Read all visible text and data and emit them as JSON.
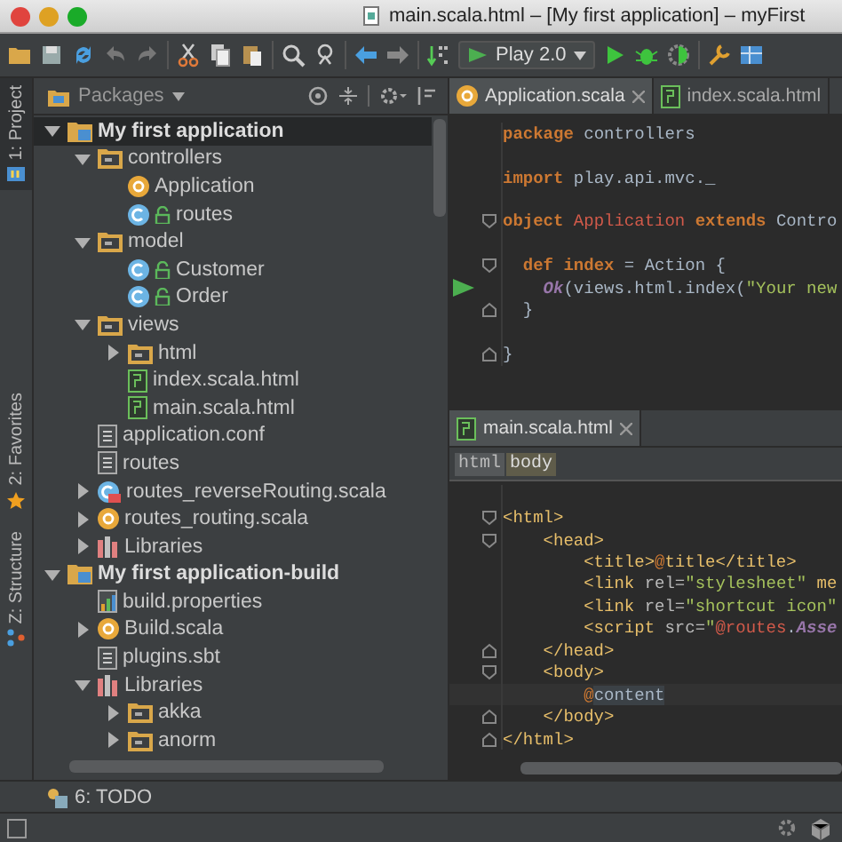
{
  "window": {
    "title": "main.scala.html – [My first application] – myFirst"
  },
  "toolbar": {
    "run_config": "Play 2.0"
  },
  "side_tabs": [
    {
      "label": "1: Project",
      "selected": true,
      "kind": "project"
    },
    {
      "label": "2: Favorites",
      "selected": false,
      "kind": "favorites"
    },
    {
      "label": "Z: Structure",
      "selected": false,
      "kind": "structure"
    }
  ],
  "project_panel": {
    "view": "Packages"
  },
  "tree": [
    {
      "label": "My first application",
      "kind": "module",
      "expanded": true,
      "selected": true,
      "children": [
        {
          "label": "controllers",
          "kind": "package",
          "expanded": true,
          "selected": false,
          "children": [
            {
              "label": "Application",
              "kind": "object",
              "selected": false
            },
            {
              "label": "routes",
              "kind": "class",
              "selected": false
            }
          ]
        },
        {
          "label": "model",
          "kind": "package",
          "expanded": true,
          "selected": false,
          "children": [
            {
              "label": "Customer",
              "kind": "class",
              "selected": false
            },
            {
              "label": "Order",
              "kind": "class",
              "selected": false
            }
          ]
        },
        {
          "label": "views",
          "kind": "package",
          "expanded": true,
          "selected": false,
          "children": [
            {
              "label": "html",
              "kind": "package",
              "expanded": false,
              "selected": false
            },
            {
              "label": "index.scala.html",
              "kind": "html",
              "selected": false
            },
            {
              "label": "main.scala.html",
              "kind": "html",
              "selected": false
            }
          ]
        },
        {
          "label": "application.conf",
          "kind": "file",
          "selected": false
        },
        {
          "label": "routes",
          "kind": "file",
          "selected": false
        },
        {
          "label": "routes_reverseRouting.scala",
          "kind": "generated",
          "expanded": false,
          "selected": false
        },
        {
          "label": "routes_routing.scala",
          "kind": "object",
          "expanded": false,
          "selected": false
        },
        {
          "label": "Libraries",
          "kind": "library",
          "expanded": false,
          "selected": false
        }
      ]
    },
    {
      "label": "My first application-build",
      "kind": "module",
      "expanded": true,
      "selected": false,
      "children": [
        {
          "label": "build.properties",
          "kind": "properties",
          "selected": false
        },
        {
          "label": "Build.scala",
          "kind": "object",
          "expanded": false,
          "selected": false
        },
        {
          "label": "plugins.sbt",
          "kind": "file",
          "selected": false
        },
        {
          "label": "Libraries",
          "kind": "library",
          "expanded": true,
          "selected": false,
          "children": [
            {
              "label": "akka",
              "kind": "package",
              "expanded": false,
              "selected": false
            },
            {
              "label": "anorm",
              "kind": "package",
              "expanded": false,
              "selected": false
            }
          ]
        }
      ]
    }
  ],
  "editor_tabs": [
    {
      "label": "Application.scala",
      "kind": "object",
      "selected": true,
      "closable": true
    },
    {
      "label": "index.scala.html",
      "kind": "html",
      "selected": false,
      "closable": false
    }
  ],
  "code_top": [
    {
      "tokens": [
        {
          "kind": "kw",
          "text": "package"
        },
        {
          "kind": "plain",
          "text": " controllers"
        }
      ]
    },
    {
      "kind": "blank"
    },
    {
      "tokens": [
        {
          "kind": "kw",
          "text": "import"
        },
        {
          "kind": "plain",
          "text": " play.api.mvc._"
        }
      ]
    },
    {
      "kind": "blank"
    },
    {
      "fold_start": true,
      "tokens": [
        {
          "kind": "kw",
          "text": "object"
        },
        {
          "kind": "cls",
          "text": " Application"
        },
        {
          "kind": "kw",
          "text": " extends"
        },
        {
          "kind": "plain",
          "text": " Contro"
        }
      ]
    },
    {
      "kind": "blank"
    },
    {
      "fold_start": true,
      "tokens": [
        {
          "kind": "kw",
          "text": "  def"
        },
        {
          "kind": "kw",
          "text": " index"
        },
        {
          "kind": "plain",
          "text": " = Action {"
        }
      ]
    },
    {
      "run": true,
      "tokens": [
        {
          "kind": "fn",
          "text": "    Ok"
        },
        {
          "kind": "plain",
          "text": "(views.html.index("
        },
        {
          "kind": "str",
          "text": "\"Your new"
        }
      ]
    },
    {
      "fold_end": true,
      "tokens": [
        {
          "kind": "plain",
          "text": "  }"
        }
      ]
    },
    {
      "kind": "blank"
    },
    {
      "fold_end": true,
      "tokens": [
        {
          "kind": "plain",
          "text": "}"
        }
      ]
    }
  ],
  "bottom_tab": {
    "label": "main.scala.html",
    "selected": true
  },
  "breadcrumbs": [
    "html",
    "body"
  ],
  "code_bottom": [
    {
      "kind": "blank"
    },
    {
      "fold_start": true,
      "tokens": [
        {
          "kind": "tag",
          "text": "<html>"
        }
      ]
    },
    {
      "fold_start": true,
      "tokens": [
        {
          "kind": "tag",
          "text": "    <head>"
        }
      ]
    },
    {
      "tokens": [
        {
          "kind": "tag",
          "text": "        <title>"
        },
        {
          "kind": "at",
          "text": "@"
        },
        {
          "kind": "tag",
          "text": "title</title>"
        }
      ]
    },
    {
      "tokens": [
        {
          "kind": "tag",
          "text": "        <link"
        },
        {
          "kind": "attr",
          "text": " rel="
        },
        {
          "kind": "str",
          "text": "\"stylesheet\""
        },
        {
          "kind": "tag",
          "text": " me"
        }
      ]
    },
    {
      "tokens": [
        {
          "kind": "tag",
          "text": "        <link"
        },
        {
          "kind": "attr",
          "text": " rel="
        },
        {
          "kind": "str",
          "text": "\"shortcut icon\""
        }
      ]
    },
    {
      "tokens": [
        {
          "kind": "tag",
          "text": "        <script"
        },
        {
          "kind": "attr",
          "text": " src="
        },
        {
          "kind": "str",
          "text": "\""
        },
        {
          "kind": "ref",
          "text": "@routes"
        },
        {
          "kind": "plain",
          "text": "."
        },
        {
          "kind": "fn",
          "text": "Asse"
        }
      ]
    },
    {
      "fold_end": true,
      "tokens": [
        {
          "kind": "tag",
          "text": "    </head>"
        }
      ]
    },
    {
      "fold_start": true,
      "tokens": [
        {
          "kind": "tag",
          "text": "    <body>"
        }
      ]
    },
    {
      "caret": true,
      "tokens": [
        {
          "kind": "at",
          "text": "        @"
        },
        {
          "kind": "hl",
          "text": "content"
        }
      ]
    },
    {
      "fold_end": true,
      "tokens": [
        {
          "kind": "tag",
          "text": "    </body>"
        }
      ]
    },
    {
      "fold_end": true,
      "tokens": [
        {
          "kind": "tag",
          "text": "</html>"
        }
      ]
    }
  ],
  "bottom_tool": {
    "label": "6: TODO"
  }
}
